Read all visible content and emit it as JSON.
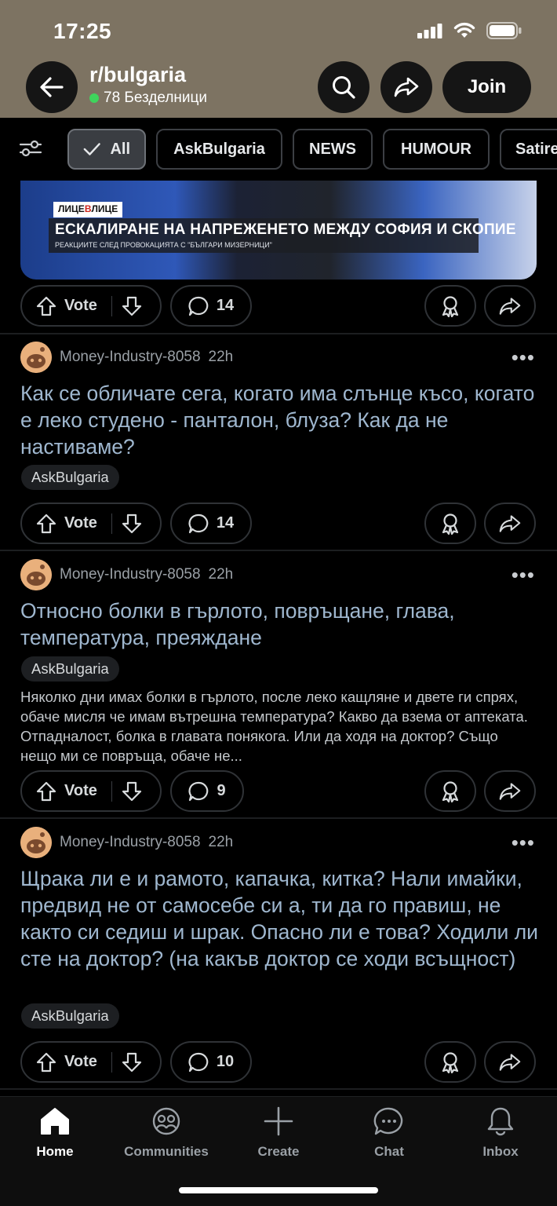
{
  "status": {
    "time": "17:25"
  },
  "header": {
    "subreddit": "r/bulgaria",
    "members": "78 Безделници",
    "join_label": "Join",
    "icons": {
      "back": "back-arrow-icon",
      "search": "search-icon",
      "share": "share-icon"
    }
  },
  "filters": {
    "chips": [
      "All",
      "AskBulgaria",
      "NEWS",
      "HUMOUR",
      "Satire"
    ]
  },
  "thumbnail": {
    "tag_left": "ЛИЦЕ",
    "tag_mid": "В",
    "tag_right": "ЛИЦЕ",
    "headline": "ЕСКАЛИРАНЕ НА НАПРЕЖЕНЕТО МЕЖДУ СОФИЯ И СКОПИЕ",
    "subhead": "РЕАКЦИИТЕ СЛЕД ПРОВОКАЦИЯТА С \"БЪЛГАРИ МИЗЕРНИЦИ\""
  },
  "vote_label": "Vote",
  "posts": [
    {
      "comments": "14"
    },
    {
      "author": "Money-Industry-8058",
      "age": "22h",
      "title": "Как се обличате сега, когато има слънце късо, когато е леко студено - панталон, блуза? Как да не настиваме?",
      "flair": "AskBulgaria",
      "comments": "14"
    },
    {
      "author": "Money-Industry-8058",
      "age": "22h",
      "title": "Относно болки в гърлото, повръщане, глава, температура, преяждане",
      "flair": "AskBulgaria",
      "body": "Няколко дни имах болки в гърлото, после леко кащляне и двете ги спрях, обаче мисля че имам вътрешна температура? Какво да взема от аптеката. Отпадналост, болка в главата понякога. Или да ходя на доктор? Също нещо ми се повръща, обаче не...",
      "comments": "9"
    },
    {
      "author": "Money-Industry-8058",
      "age": "22h",
      "title": "Щрака ли е и рамото, капачка, китка? Нали имайки, предвид не от самосебе си а, ти да го правиш, не както си седиш и шрак. Опасно ли е това? Ходили ли сте на доктор? (на какъв доктор се ходи всъщност)",
      "flair": "AskBulgaria",
      "comments": "10"
    }
  ],
  "bottom_nav": [
    {
      "label": "Home",
      "icon": "home-icon"
    },
    {
      "label": "Communities",
      "icon": "communities-icon"
    },
    {
      "label": "Create",
      "icon": "plus-icon"
    },
    {
      "label": "Chat",
      "icon": "chat-icon"
    },
    {
      "label": "Inbox",
      "icon": "bell-icon"
    }
  ]
}
